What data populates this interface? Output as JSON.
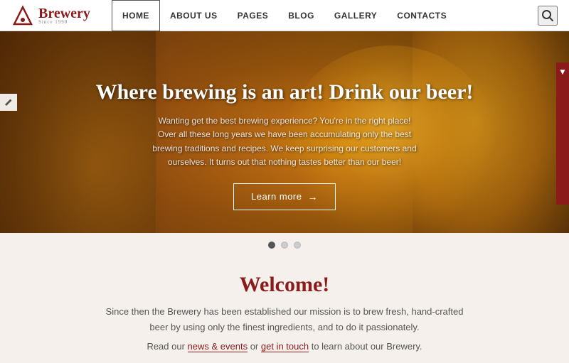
{
  "header": {
    "logo_text": "Brewery",
    "logo_sub": "Since 1990",
    "nav": [
      {
        "label": "HOME",
        "id": "home",
        "active": true
      },
      {
        "label": "ABOUT US",
        "id": "about"
      },
      {
        "label": "PAGES",
        "id": "pages"
      },
      {
        "label": "BLOG",
        "id": "blog"
      },
      {
        "label": "GALLERY",
        "id": "gallery"
      },
      {
        "label": "CONTACTS",
        "id": "contacts"
      }
    ]
  },
  "hero": {
    "title": "Where brewing is an art! Drink our beer!",
    "subtitle_line1": "Wanting get the best brewing experience? You're in the right place!",
    "subtitle_body": "Over all these long years we have been accumulating only the best brewing traditions and recipes. We keep surprising our customers and ourselves. It turns out that nothing tastes better than our beer!",
    "btn_label": "Learn more"
  },
  "slides": [
    {
      "active": true
    },
    {
      "active": false
    },
    {
      "active": false
    }
  ],
  "welcome": {
    "title": "Welcome!",
    "text": "Since then the Brewery has been established our mission is to brew fresh, hand-crafted beer by using only the finest ingredients, and to do it passionately.",
    "link_text1": "news & events",
    "link_text2": "get in touch",
    "bottom_text": " to learn about our Brewery.",
    "read_our": "Read our ",
    "or_text": " or "
  }
}
